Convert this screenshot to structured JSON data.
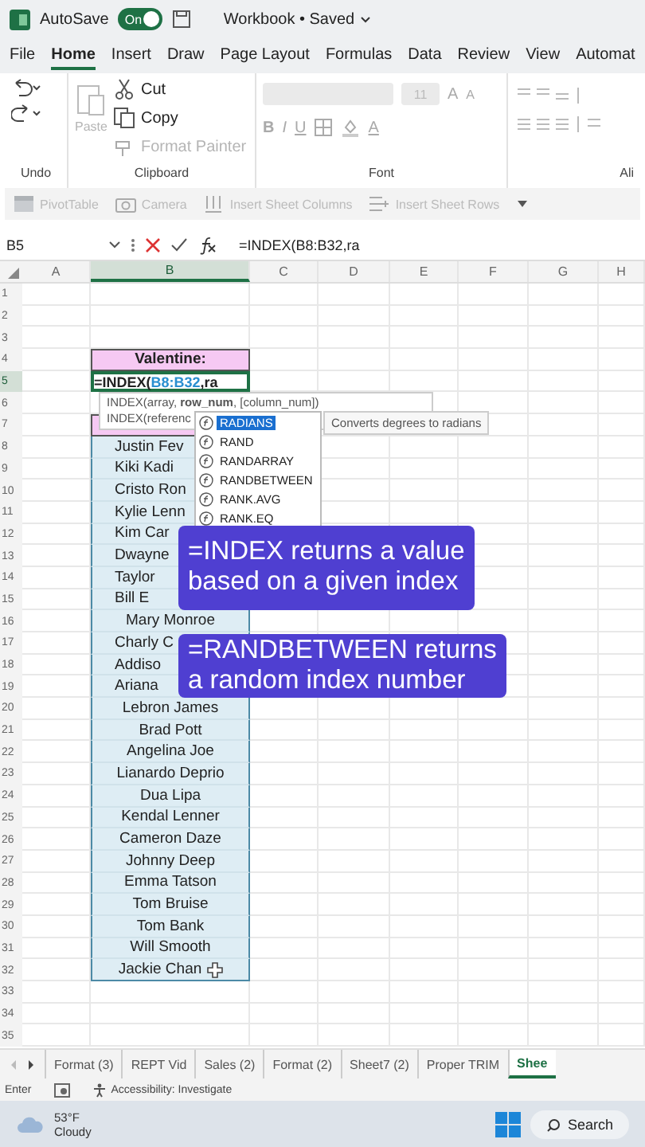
{
  "title_bar": {
    "autosave_label": "AutoSave",
    "autosave_toggle": {
      "label": "On",
      "on": true
    },
    "document_title": "Workbook • Saved"
  },
  "menu_tabs": [
    {
      "label": "File",
      "selected": false
    },
    {
      "label": "Home",
      "selected": true
    },
    {
      "label": "Insert",
      "selected": false
    },
    {
      "label": "Draw",
      "selected": false
    },
    {
      "label": "Page Layout",
      "selected": false
    },
    {
      "label": "Formulas",
      "selected": false
    },
    {
      "label": "Data",
      "selected": false
    },
    {
      "label": "Review",
      "selected": false
    },
    {
      "label": "View",
      "selected": false
    },
    {
      "label": "Automat",
      "selected": false
    }
  ],
  "ribbon": {
    "undo_group": {
      "label": "Undo"
    },
    "clipboard": {
      "label": "Clipboard",
      "paste": {
        "label": "Paste",
        "disabled": true
      },
      "actions": [
        {
          "label": "Cut",
          "kind": "cut",
          "disabled": false
        },
        {
          "label": "Copy",
          "kind": "copy",
          "disabled": false
        },
        {
          "label": "Format Painter",
          "kind": "painter",
          "disabled": true
        }
      ]
    },
    "font": {
      "label": "Font",
      "size": "11",
      "grow": "A",
      "shrink": "A",
      "bold": "B",
      "italic": "I",
      "underline": "U",
      "font_color": "A"
    },
    "alignment": {
      "label": "Ali"
    }
  },
  "quick_toolbar": [
    {
      "label": "PivotTable",
      "kind": "pivot",
      "disabled": true
    },
    {
      "label": "Camera",
      "kind": "camera",
      "disabled": true
    },
    {
      "label": "Insert Sheet Columns",
      "kind": "columns",
      "disabled": true
    },
    {
      "label": "Insert Sheet Rows",
      "kind": "rows",
      "disabled": true
    }
  ],
  "formula_bar": {
    "name_box": "B5",
    "formula": "=INDEX(B8:B32,ra"
  },
  "columns": [
    {
      "label": "A",
      "selected": false
    },
    {
      "label": "B",
      "selected": true
    },
    {
      "label": "C",
      "selected": false
    },
    {
      "label": "D",
      "selected": false
    },
    {
      "label": "E",
      "selected": false
    },
    {
      "label": "F",
      "selected": false
    },
    {
      "label": "G",
      "selected": false
    },
    {
      "label": "H",
      "selected": false
    }
  ],
  "rows": [
    {
      "number": "1",
      "selected": false
    },
    {
      "number": "2",
      "selected": false
    },
    {
      "number": "3",
      "selected": false
    },
    {
      "number": "4",
      "selected": false,
      "cell_b": {
        "kind": "header",
        "text": "Valentine:"
      }
    },
    {
      "number": "5",
      "selected": true,
      "cell_b": {
        "kind": "formula",
        "prefix": "=INDEX(",
        "ref": "B8:B32",
        "suffix": ",ra"
      }
    },
    {
      "number": "6",
      "selected": false
    },
    {
      "number": "7",
      "selected": false,
      "cell_b": {
        "kind": "header"
      }
    },
    {
      "number": "8",
      "selected": false,
      "cell_b": {
        "kind": "name",
        "text": "Justin Fev",
        "cut": true
      }
    },
    {
      "number": "9",
      "selected": false,
      "cell_b": {
        "kind": "name",
        "text": "Kiki Kadi",
        "cut": true
      }
    },
    {
      "number": "10",
      "selected": false,
      "cell_b": {
        "kind": "name",
        "text": "Cristo Ron",
        "cut": true
      }
    },
    {
      "number": "11",
      "selected": false,
      "cell_b": {
        "kind": "name",
        "text": "Kylie Lenn",
        "cut": true
      }
    },
    {
      "number": "12",
      "selected": false,
      "cell_b": {
        "kind": "name",
        "text": "Kim Car",
        "cut": true
      }
    },
    {
      "number": "13",
      "selected": false,
      "cell_b": {
        "kind": "name",
        "text": "Dwayne",
        "cut": true
      }
    },
    {
      "number": "14",
      "selected": false,
      "cell_b": {
        "kind": "name",
        "text": "Taylor",
        "cut": true
      }
    },
    {
      "number": "15",
      "selected": false,
      "cell_b": {
        "kind": "name",
        "text": "Bill E",
        "cut": true
      }
    },
    {
      "number": "16",
      "selected": false,
      "cell_b": {
        "kind": "name",
        "text": "Mary Monroe"
      }
    },
    {
      "number": "17",
      "selected": false,
      "cell_b": {
        "kind": "name",
        "text": "Charly C",
        "cut": true
      }
    },
    {
      "number": "18",
      "selected": false,
      "cell_b": {
        "kind": "name",
        "text": "Addiso",
        "cut": true
      }
    },
    {
      "number": "19",
      "selected": false,
      "cell_b": {
        "kind": "name",
        "text": "Ariana",
        "cut": true
      }
    },
    {
      "number": "20",
      "selected": false,
      "cell_b": {
        "kind": "name",
        "text": "Lebron James"
      }
    },
    {
      "number": "21",
      "selected": false,
      "cell_b": {
        "kind": "name",
        "text": "Brad Pott"
      }
    },
    {
      "number": "22",
      "selected": false,
      "cell_b": {
        "kind": "name",
        "text": "Angelina Joe"
      }
    },
    {
      "number": "23",
      "selected": false,
      "cell_b": {
        "kind": "name",
        "text": "Lianardo Deprio"
      }
    },
    {
      "number": "24",
      "selected": false,
      "cell_b": {
        "kind": "name",
        "text": "Dua Lipa"
      }
    },
    {
      "number": "25",
      "selected": false,
      "cell_b": {
        "kind": "name",
        "text": "Kendal Lenner"
      }
    },
    {
      "number": "26",
      "selected": false,
      "cell_b": {
        "kind": "name",
        "text": "Cameron Daze"
      }
    },
    {
      "number": "27",
      "selected": false,
      "cell_b": {
        "kind": "name",
        "text": "Johnny Deep"
      }
    },
    {
      "number": "28",
      "selected": false,
      "cell_b": {
        "kind": "name",
        "text": "Emma Tatson"
      }
    },
    {
      "number": "29",
      "selected": false,
      "cell_b": {
        "kind": "name",
        "text": "Tom Bruise"
      }
    },
    {
      "number": "30",
      "selected": false,
      "cell_b": {
        "kind": "name",
        "text": "Tom Bank"
      }
    },
    {
      "number": "31",
      "selected": false,
      "cell_b": {
        "kind": "name",
        "text": "Will Smooth"
      }
    },
    {
      "number": "32",
      "selected": false,
      "cell_b": {
        "kind": "name",
        "text": "Jackie Chan",
        "cursor": true
      }
    },
    {
      "number": "33",
      "selected": false
    },
    {
      "number": "34",
      "selected": false
    },
    {
      "number": "35",
      "selected": false
    }
  ],
  "autocomplete": {
    "hints": [
      "INDEX(array, **row_num**, [column_num])",
      "INDEX(referenc"
    ],
    "items": [
      {
        "label": "RADIANS",
        "selected": true
      },
      {
        "label": "RAND",
        "selected": false
      },
      {
        "label": "RANDARRAY",
        "selected": false
      },
      {
        "label": "RANDBETWEEN",
        "selected": false
      },
      {
        "label": "RANK.AVG",
        "selected": false
      },
      {
        "label": "RANK.EQ",
        "selected": false
      }
    ],
    "description": "Converts degrees to radians"
  },
  "captions": [
    {
      "lines": [
        "=INDEX returns a value",
        "based on a given index"
      ]
    },
    {
      "lines": [
        "=RANDBETWEEN returns",
        "a random index number"
      ]
    }
  ],
  "sheet_tabs": [
    {
      "label": "Format (3)",
      "selected": false
    },
    {
      "label": "REPT Vid",
      "selected": false
    },
    {
      "label": "Sales (2)",
      "selected": false
    },
    {
      "label": "Format (2)",
      "selected": false
    },
    {
      "label": "Sheet7 (2)",
      "selected": false
    },
    {
      "label": "Proper TRIM",
      "selected": false
    },
    {
      "label": "Shee",
      "selected": true
    }
  ],
  "status_bar": {
    "mode": "Enter",
    "accessibility": "Accessibility: Investigate"
  },
  "taskbar": {
    "temperature": "53°F",
    "condition": "Cloudy",
    "search": "Search"
  }
}
